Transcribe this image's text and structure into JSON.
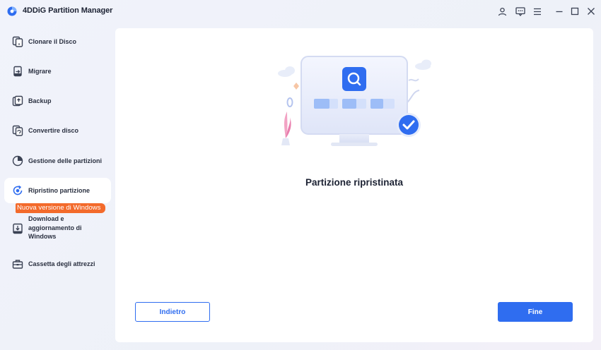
{
  "app": {
    "title": "4DDiG Partition Manager"
  },
  "sidebar": {
    "items": [
      {
        "label": "Clonare il Disco",
        "icon": "clone-disk-icon"
      },
      {
        "label": "Migrare",
        "icon": "migrate-icon"
      },
      {
        "label": "Backup",
        "icon": "backup-icon"
      },
      {
        "label": "Convertire disco",
        "icon": "convert-disk-icon"
      },
      {
        "label": "Gestione delle partizioni",
        "icon": "partition-pie-icon"
      },
      {
        "label": "Ripristino partizione",
        "icon": "partition-recovery-icon",
        "active": true
      },
      {
        "label": "Download e aggiornamento di Windows",
        "icon": "windows-download-icon",
        "badge": "Nuova versione di Windows"
      },
      {
        "label": "Cassetta degli attrezzi",
        "icon": "toolbox-icon"
      }
    ]
  },
  "main": {
    "status_title": "Partizione ripristinata",
    "back_label": "Indietro",
    "finish_label": "Fine"
  },
  "colors": {
    "accent": "#2f6df0",
    "badge": "#f36a2b",
    "success": "#2f6df0"
  }
}
